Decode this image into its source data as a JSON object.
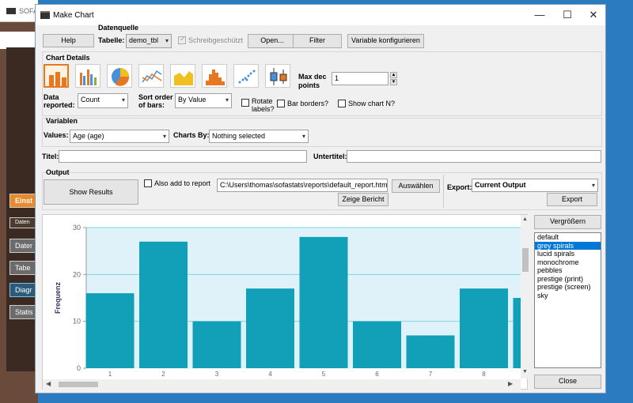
{
  "background_app": {
    "title": "SOFA",
    "buttons": [
      "Einst",
      "Daten",
      "Dater",
      "Tabe",
      "Diagr",
      "Statis"
    ]
  },
  "window": {
    "title": "Make Chart",
    "controls": {
      "minimize": "—",
      "maximize": "☐",
      "close": "✕"
    }
  },
  "datasource": {
    "help_label": "Help",
    "section_label": "Datenquelle",
    "table_label": "Tabelle:",
    "table_value": "demo_tbl",
    "readonly_label": "Schreibgeschützt",
    "open_label": "Open...",
    "filter_label": "Filter",
    "config_vars_label": "Variable konfigurieren"
  },
  "chart_details": {
    "section_label": "Chart Details",
    "chart_types": [
      "bar",
      "clustered-bar",
      "pie",
      "line",
      "area",
      "histogram",
      "scatter",
      "boxplot"
    ],
    "selected_type": "bar",
    "max_dec_label": "Max dec",
    "max_dec_label2": "points",
    "max_dec_value": "1",
    "data_reported_label": "Data",
    "data_reported_label2": "reported:",
    "data_reported_value": "Count",
    "sort_label": "Sort order",
    "sort_label2": "of bars:",
    "sort_value": "By Value",
    "rotate_label": "Rotate",
    "rotate_label2": "labels?",
    "bar_borders_label": "Bar borders?",
    "show_n_label": "Show chart N?"
  },
  "variables": {
    "section_label": "Variablen",
    "values_label": "Values:",
    "values_value": "Age (age)",
    "charts_by_label": "Charts By:",
    "charts_by_value": "Nothing selected"
  },
  "titles": {
    "title_label": "Titel:",
    "title_value": "",
    "subtitle_label": "Untertitel:",
    "subtitle_value": ""
  },
  "output": {
    "section_label": "Output",
    "show_results_label": "Show Results",
    "add_to_report_label": "Also add to report",
    "report_path": "C:\\Users\\thomas\\sofastats\\reports\\default_report.htm",
    "browse_label": "Auswählen",
    "show_report_label": "Zeige Bericht",
    "export_label": "Export:",
    "export_value": "Current Output",
    "export_button_label": "Export"
  },
  "side": {
    "enlarge_label": "Vergrößern",
    "styles": [
      "default",
      "grey spirals",
      "lucid spirals",
      "monochrome",
      "pebbles",
      "prestige (print)",
      "prestige (screen)",
      "sky"
    ],
    "selected_style": "grey spirals",
    "close_label": "Close"
  },
  "colors": {
    "bar": "#12a0b8",
    "plot_bg": "#dff2fa",
    "gridline": "#7fd6dc",
    "axis_label": "#333366",
    "selected_type_border": "#e87722"
  },
  "chart_data": {
    "type": "bar",
    "ylabel": "Frequenz",
    "xlabel": "",
    "ylim": [
      0,
      30
    ],
    "yticks": [
      0,
      10,
      20,
      30
    ],
    "categories": [
      "1",
      "2",
      "3",
      "4",
      "5",
      "6",
      "7",
      "8",
      ""
    ],
    "values": [
      16,
      27,
      10,
      17,
      28,
      10,
      7,
      17,
      15
    ],
    "grid": true
  }
}
